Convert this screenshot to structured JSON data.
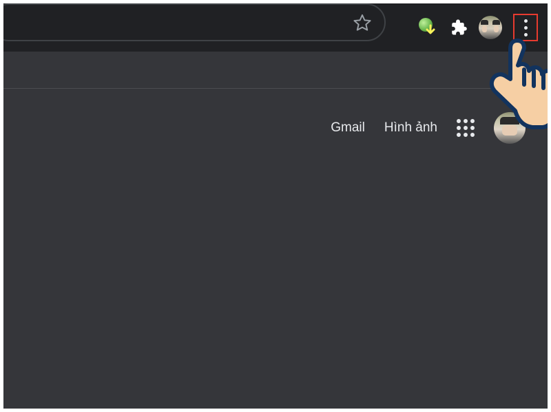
{
  "toolbar": {
    "bookmark_icon": "star-outline-icon",
    "extensions": [
      {
        "name": "idm-download-icon"
      },
      {
        "name": "extensions-puzzle-icon"
      }
    ],
    "profile_avatar": "user-avatar-icon",
    "menu_icon": "more-vertical-icon"
  },
  "header": {
    "gmail_label": "Gmail",
    "images_label": "Hình ảnh",
    "apps_icon": "google-apps-icon",
    "account_avatar": "account-avatar-icon"
  },
  "annotations": {
    "highlight_target": "chrome-menu-button",
    "cursor": "pointing-hand-cursor"
  }
}
